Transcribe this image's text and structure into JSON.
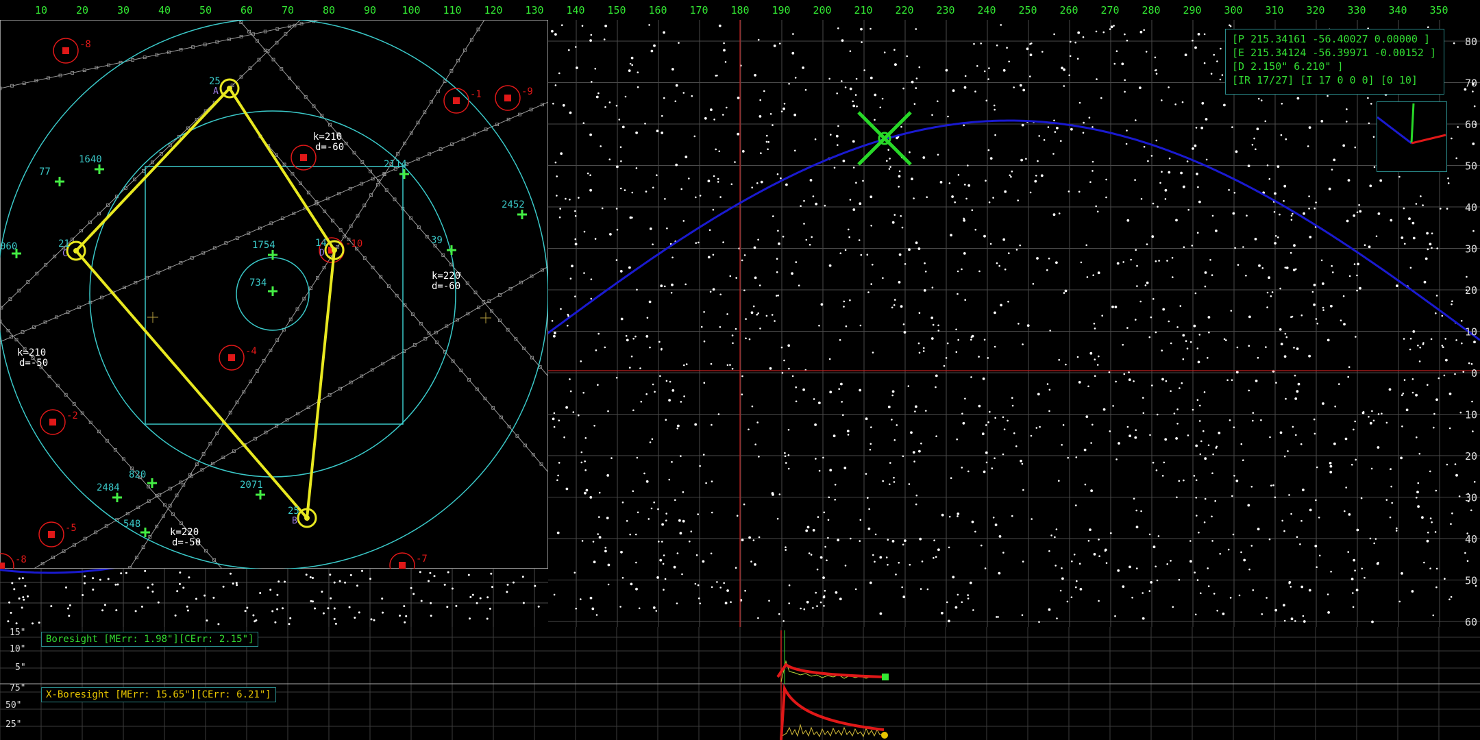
{
  "top_axis": {
    "inset_ticks": [
      "10",
      "20",
      "30",
      "40",
      "50",
      "60",
      "70",
      "80",
      "90",
      "100",
      "110",
      "120",
      "130"
    ],
    "main_ticks": [
      "140",
      "150",
      "160",
      "170",
      "180",
      "190",
      "200",
      "210",
      "220",
      "230",
      "240",
      "250",
      "260",
      "270",
      "280",
      "290",
      "300",
      "310",
      "320",
      "330",
      "340",
      "350"
    ]
  },
  "right_axis": {
    "ticks": [
      "80",
      "70",
      "60",
      "50",
      "40",
      "30",
      "20",
      "10",
      "0",
      "10",
      "20",
      "30",
      "40",
      "50",
      "60"
    ]
  },
  "readout": {
    "line1": "[P 215.34161 -56.40027 0.00000 ]",
    "line2": "[E 215.34124 -56.39971 -0.00152 ]",
    "line3": "[D 2.150\" 6.210\" ]",
    "line4": "[IR 17/27] [I 17 0 0 0] [0 10]"
  },
  "inset": {
    "matched_stars": [
      {
        "id": "77",
        "label": "77"
      },
      {
        "id": "1640",
        "label": "1640"
      },
      {
        "id": "2114",
        "label": "2114"
      },
      {
        "id": "2452",
        "label": "2452"
      },
      {
        "id": "1754",
        "label": "1754"
      },
      {
        "id": "734",
        "label": "734"
      },
      {
        "id": "39",
        "label": "39"
      },
      {
        "id": "060",
        "label": "060"
      },
      {
        "id": "820",
        "label": "820"
      },
      {
        "id": "2484",
        "label": "2484"
      },
      {
        "id": "2071",
        "label": "2071"
      },
      {
        "id": "548",
        "label": "548"
      }
    ],
    "vertices": [
      {
        "id": "A",
        "label": "25",
        "letter": "A"
      },
      {
        "id": "B",
        "label": "25",
        "letter": "B"
      },
      {
        "id": "C",
        "label": "21",
        "letter": "C"
      },
      {
        "id": "D",
        "label": "14",
        "letter": "D"
      }
    ],
    "red_sources": [
      "-8",
      "-1",
      "-9",
      "-10",
      "-4",
      "-2",
      "-5",
      "-7",
      "-8"
    ],
    "grid_labels": [
      {
        "k": "k=210",
        "d": "d=-60"
      },
      {
        "k": "k=220",
        "d": "d=-60"
      },
      {
        "k": "k=210",
        "d": "d=-50"
      },
      {
        "k": "k=220",
        "d": "d=-50"
      }
    ]
  },
  "boresight": {
    "label": "Boresight [MErr: 1.98\"][CErr: 2.15\"]",
    "yticks": [
      "15\"",
      "10\"",
      "5\""
    ]
  },
  "x_boresight": {
    "label": "X-Boresight [MErr: 15.65\"][CErr: 6.21\"]",
    "yticks": [
      "75\"",
      "50\"",
      "25\""
    ]
  },
  "colors": {
    "grid": "#555555",
    "curve": "#1a1ad0",
    "cyan": "#3ac8c8",
    "yellow": "#e8e820",
    "red": "#e01818",
    "green": "#33e833",
    "target": "#28d828"
  }
}
